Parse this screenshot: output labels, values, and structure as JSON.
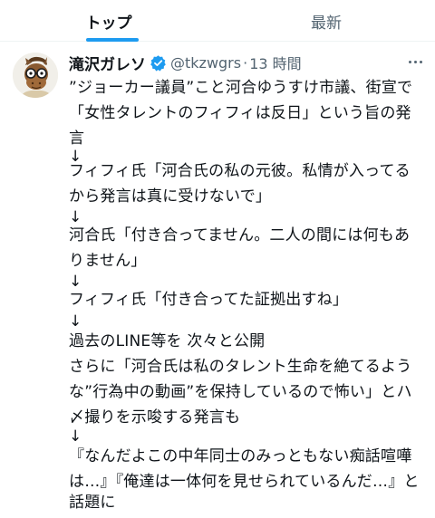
{
  "tabs": [
    {
      "label": "トップ",
      "active": true
    },
    {
      "label": "最新",
      "active": false
    }
  ],
  "accent_color": "#1d9bf0",
  "tweet": {
    "display_name": "滝沢ガレソ",
    "verified": true,
    "handle": "@tkzwgrs",
    "separator": "·",
    "time": "13 時間",
    "avatar_icon": "horse-character-avatar",
    "lines": [
      "”ジョーカー議員”こと河合ゆうすけ市議、街宣で",
      "「女性タレントのフィフィは反日」という旨の発",
      "言",
      "↓",
      "フィフィ氏「河合氏の私の元彼。私情が入ってる",
      "から発言は真に受けないで」",
      "↓",
      "河合氏「付き合ってません。二人の間には何もあ",
      "りません」",
      "↓",
      "フィフィ氏「付き合ってた証拠出すね」",
      "↓",
      "過去のLINE等を 次々と公開",
      "さらに「河合氏は私のタレント生命を絶てるよう",
      "な”行為中の動画”を保持しているので怖い」とハ",
      "〆撮りを示唆する発言も",
      "↓",
      "『なんだよこの中年同士のみっともない痴話喧嘩",
      "は…』『俺達は一体何を見せられているんだ…』と",
      "話題に"
    ]
  }
}
